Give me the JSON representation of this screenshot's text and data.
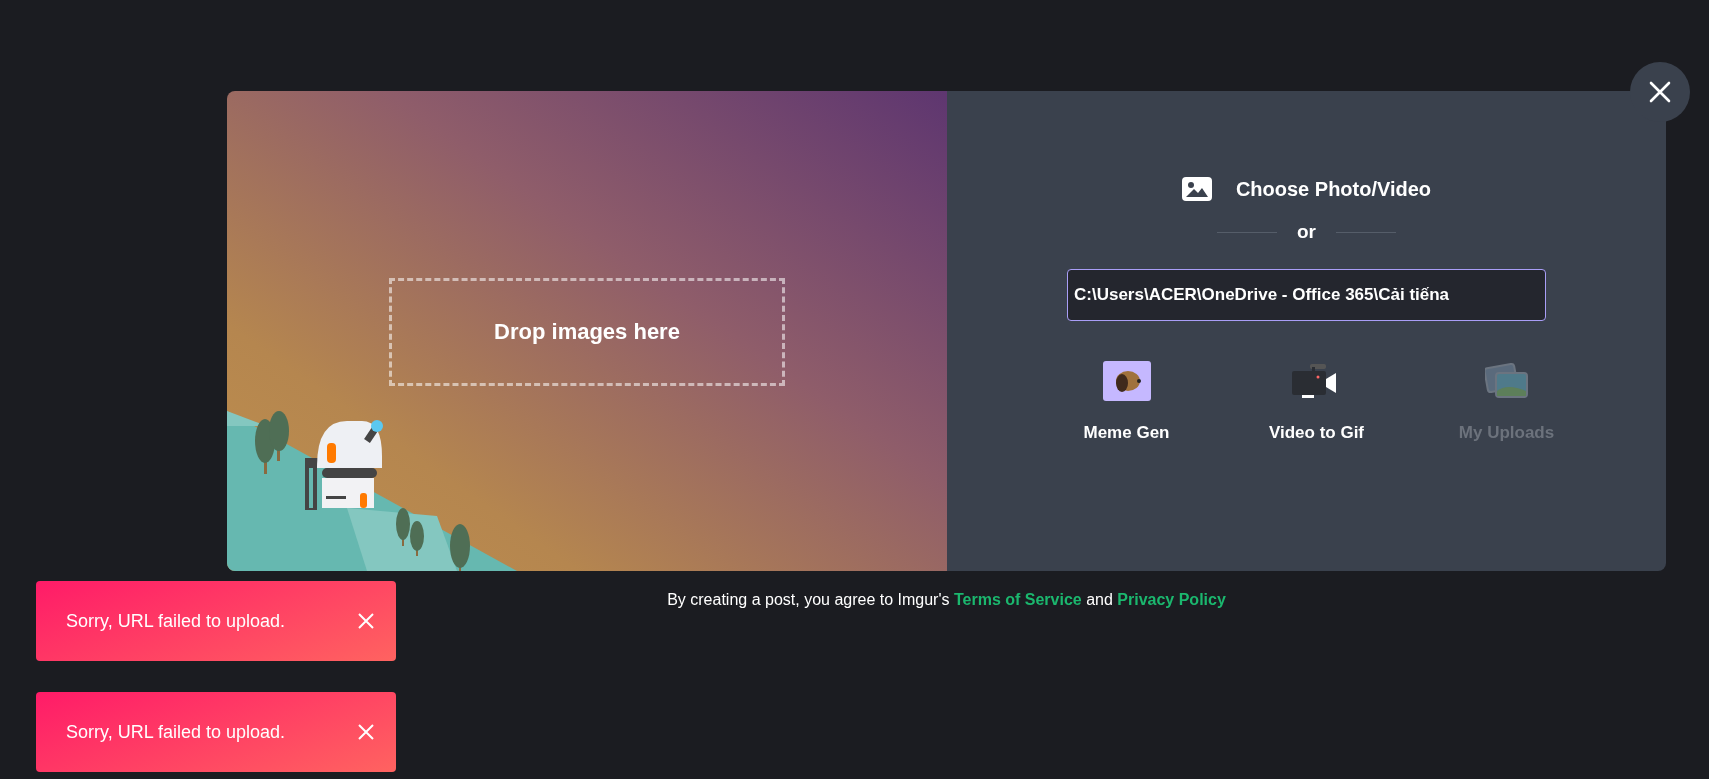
{
  "upload_dialog": {
    "drop_zone": {
      "label": "Drop images here"
    },
    "choose_button": {
      "label": "Choose Photo/Video"
    },
    "divider": {
      "label": "or"
    },
    "url_field": {
      "value": "C:\\Users\\ACER\\OneDrive - Office 365\\Cải tiếna",
      "focused": true
    },
    "tools": [
      {
        "kind": "meme",
        "label": "Meme Gen",
        "disabled": false
      },
      {
        "kind": "video",
        "label": "Video to Gif",
        "disabled": false
      },
      {
        "kind": "uploads",
        "label": "My Uploads",
        "disabled": true
      }
    ]
  },
  "footer": {
    "text_before": "By creating a post, you agree to Imgur's",
    "terms_link": "Terms of Service",
    "text_middle": "and",
    "privacy_link": "Privacy Policy"
  },
  "toasts": [
    {
      "message": "Sorry, URL failed to upload."
    },
    {
      "message": "Sorry, URL failed to upload."
    }
  ]
}
